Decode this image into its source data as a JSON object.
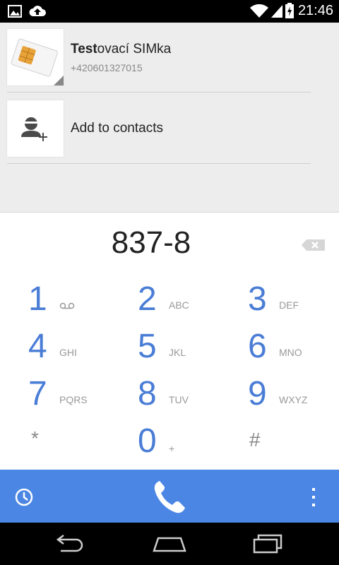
{
  "status_bar": {
    "time": "21:46",
    "left_icons": [
      "image-icon",
      "cloud-upload-icon"
    ],
    "right_icons": [
      "wifi-icon",
      "signal-icon",
      "battery-icon"
    ]
  },
  "results": [
    {
      "name_bold": "Test",
      "name_rest": "ovací SIMka",
      "number": "+420601327015",
      "icon": "sim-card-icon"
    },
    {
      "label": "Add to contacts",
      "icon": "add-contact-icon"
    }
  ],
  "dialpad": {
    "entered_digits": "837-8",
    "keys": [
      {
        "digit": "1",
        "letters": ""
      },
      {
        "digit": "2",
        "letters": "ABC"
      },
      {
        "digit": "3",
        "letters": "DEF"
      },
      {
        "digit": "4",
        "letters": "GHI"
      },
      {
        "digit": "5",
        "letters": "JKL"
      },
      {
        "digit": "6",
        "letters": "MNO"
      },
      {
        "digit": "7",
        "letters": "PQRS"
      },
      {
        "digit": "8",
        "letters": "TUV"
      },
      {
        "digit": "9",
        "letters": "WXYZ"
      },
      {
        "digit": "*",
        "letters": ""
      },
      {
        "digit": "0",
        "letters": "+"
      },
      {
        "digit": "#",
        "letters": ""
      }
    ]
  },
  "colors": {
    "accent": "#4b86e4",
    "digit": "#4a7dd6"
  }
}
